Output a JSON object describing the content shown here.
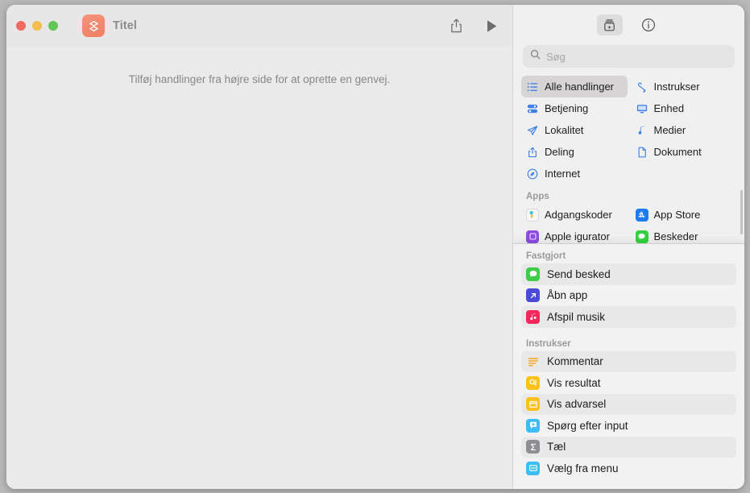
{
  "window": {
    "title": "Titel",
    "app_icon": "shortcuts-icon",
    "traffic_lights": [
      "close",
      "minimize",
      "zoom"
    ]
  },
  "toolbar": {
    "share_icon": "share-icon",
    "run_icon": "play-icon"
  },
  "canvas": {
    "hint": "Tilføj handlinger fra højre side for at oprette en genvej."
  },
  "sidebar": {
    "tools": [
      {
        "name": "action-library-icon",
        "selected": true
      },
      {
        "name": "info-icon",
        "selected": false
      }
    ],
    "search": {
      "placeholder": "Søg",
      "value": ""
    },
    "categories": [
      {
        "label": "Alle handlinger",
        "icon": "list-icon",
        "selected": true,
        "color": "#3b7fe8"
      },
      {
        "label": "Instrukser",
        "icon": "scroll-icon",
        "selected": false,
        "color": "#3b7fe8"
      },
      {
        "label": "Betjening",
        "icon": "sliders-icon",
        "selected": false,
        "color": "#3b7fe8"
      },
      {
        "label": "Enhed",
        "icon": "display-icon",
        "selected": false,
        "color": "#3b7fe8"
      },
      {
        "label": "Lokalitet",
        "icon": "paperplane-icon",
        "selected": false,
        "color": "#3b7fe8"
      },
      {
        "label": "Medier",
        "icon": "music-note-icon",
        "selected": false,
        "color": "#3b7fe8"
      },
      {
        "label": "Deling",
        "icon": "share-icon",
        "selected": false,
        "color": "#3b7fe8"
      },
      {
        "label": "Dokument",
        "icon": "document-icon",
        "selected": false,
        "color": "#3b7fe8"
      },
      {
        "label": "Internet",
        "icon": "compass-icon",
        "selected": false,
        "color": "#3b7fe8"
      }
    ],
    "apps_header": "Apps",
    "apps": [
      {
        "label": "Adgangskoder",
        "icon": "passwords-app-icon",
        "color": "#f4f4f4"
      },
      {
        "label": "App Store",
        "icon": "appstore-app-icon",
        "color": "#1f7bf2"
      },
      {
        "label": "Apple  igurator",
        "icon": "configurator-app-icon",
        "color": "#8b4ce0"
      },
      {
        "label": "Beskeder",
        "icon": "messages-app-icon",
        "color": "#34d03f"
      }
    ]
  },
  "popover": {
    "pinned_header": "Fastgjort",
    "pinned": [
      {
        "label": "Send besked",
        "icon": "messages-icon",
        "color": "#3ecc4a"
      },
      {
        "label": "Åbn app",
        "icon": "open-app-icon",
        "color": "#4b4bd8"
      },
      {
        "label": "Afspil musik",
        "icon": "music-icon",
        "color": "#f5265c"
      }
    ],
    "scripting_header": "Instrukser",
    "scripting": [
      {
        "label": "Kommentar",
        "icon": "comment-icon",
        "color": "#f5a623"
      },
      {
        "label": "Vis resultat",
        "icon": "quicklook-icon",
        "color": "#fcc11a"
      },
      {
        "label": "Vis advarsel",
        "icon": "alert-icon",
        "color": "#fcc11a"
      },
      {
        "label": "Spørg efter input",
        "icon": "ask-input-icon",
        "color": "#3dbdf5"
      },
      {
        "label": "Tæl",
        "icon": "sigma-icon",
        "color": "#8e8e93"
      },
      {
        "label": "Vælg fra menu",
        "icon": "choose-menu-icon",
        "color": "#3dbdf5"
      }
    ]
  },
  "colors": {
    "accent_blue": "#3b7fe8",
    "app_icon_orange": "#ee7f63",
    "window_bg": "#eeeeee",
    "sidebar_bg": "#f0f0f0"
  }
}
